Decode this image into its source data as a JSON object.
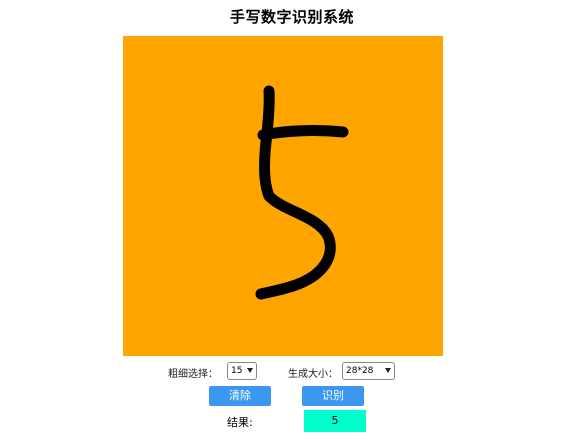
{
  "header": {
    "title": "手写数字识别系统"
  },
  "canvas": {
    "background_color": "#ffa500",
    "stroke_color": "#000000",
    "drawn_digit": "5"
  },
  "controls": {
    "thickness_label": "粗细选择：",
    "thickness_value": "15",
    "size_label": "生成大小：",
    "size_value": "28*28"
  },
  "buttons": {
    "clear_label": "清除",
    "recognize_label": "识别",
    "color": "#3b97f0"
  },
  "result": {
    "label": "结果:",
    "value": "5",
    "box_color": "#00ffcc"
  }
}
